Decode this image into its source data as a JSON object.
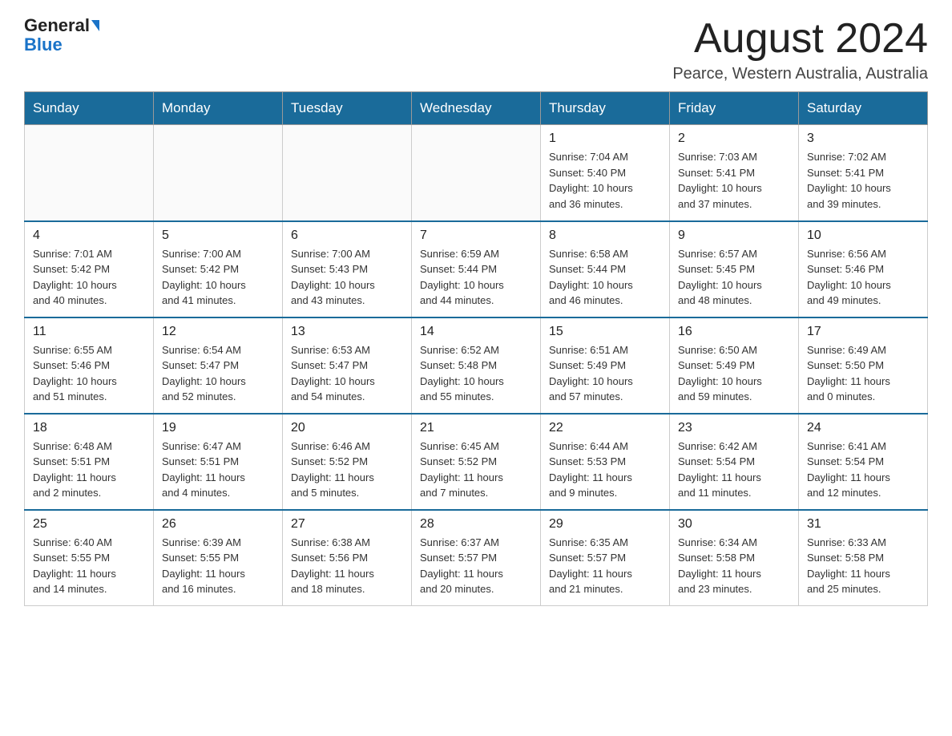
{
  "header": {
    "logo_general": "General",
    "logo_blue": "Blue",
    "month_title": "August 2024",
    "location": "Pearce, Western Australia, Australia"
  },
  "weekdays": [
    "Sunday",
    "Monday",
    "Tuesday",
    "Wednesday",
    "Thursday",
    "Friday",
    "Saturday"
  ],
  "weeks": [
    {
      "days": [
        {
          "num": "",
          "info": ""
        },
        {
          "num": "",
          "info": ""
        },
        {
          "num": "",
          "info": ""
        },
        {
          "num": "",
          "info": ""
        },
        {
          "num": "1",
          "info": "Sunrise: 7:04 AM\nSunset: 5:40 PM\nDaylight: 10 hours\nand 36 minutes."
        },
        {
          "num": "2",
          "info": "Sunrise: 7:03 AM\nSunset: 5:41 PM\nDaylight: 10 hours\nand 37 minutes."
        },
        {
          "num": "3",
          "info": "Sunrise: 7:02 AM\nSunset: 5:41 PM\nDaylight: 10 hours\nand 39 minutes."
        }
      ]
    },
    {
      "days": [
        {
          "num": "4",
          "info": "Sunrise: 7:01 AM\nSunset: 5:42 PM\nDaylight: 10 hours\nand 40 minutes."
        },
        {
          "num": "5",
          "info": "Sunrise: 7:00 AM\nSunset: 5:42 PM\nDaylight: 10 hours\nand 41 minutes."
        },
        {
          "num": "6",
          "info": "Sunrise: 7:00 AM\nSunset: 5:43 PM\nDaylight: 10 hours\nand 43 minutes."
        },
        {
          "num": "7",
          "info": "Sunrise: 6:59 AM\nSunset: 5:44 PM\nDaylight: 10 hours\nand 44 minutes."
        },
        {
          "num": "8",
          "info": "Sunrise: 6:58 AM\nSunset: 5:44 PM\nDaylight: 10 hours\nand 46 minutes."
        },
        {
          "num": "9",
          "info": "Sunrise: 6:57 AM\nSunset: 5:45 PM\nDaylight: 10 hours\nand 48 minutes."
        },
        {
          "num": "10",
          "info": "Sunrise: 6:56 AM\nSunset: 5:46 PM\nDaylight: 10 hours\nand 49 minutes."
        }
      ]
    },
    {
      "days": [
        {
          "num": "11",
          "info": "Sunrise: 6:55 AM\nSunset: 5:46 PM\nDaylight: 10 hours\nand 51 minutes."
        },
        {
          "num": "12",
          "info": "Sunrise: 6:54 AM\nSunset: 5:47 PM\nDaylight: 10 hours\nand 52 minutes."
        },
        {
          "num": "13",
          "info": "Sunrise: 6:53 AM\nSunset: 5:47 PM\nDaylight: 10 hours\nand 54 minutes."
        },
        {
          "num": "14",
          "info": "Sunrise: 6:52 AM\nSunset: 5:48 PM\nDaylight: 10 hours\nand 55 minutes."
        },
        {
          "num": "15",
          "info": "Sunrise: 6:51 AM\nSunset: 5:49 PM\nDaylight: 10 hours\nand 57 minutes."
        },
        {
          "num": "16",
          "info": "Sunrise: 6:50 AM\nSunset: 5:49 PM\nDaylight: 10 hours\nand 59 minutes."
        },
        {
          "num": "17",
          "info": "Sunrise: 6:49 AM\nSunset: 5:50 PM\nDaylight: 11 hours\nand 0 minutes."
        }
      ]
    },
    {
      "days": [
        {
          "num": "18",
          "info": "Sunrise: 6:48 AM\nSunset: 5:51 PM\nDaylight: 11 hours\nand 2 minutes."
        },
        {
          "num": "19",
          "info": "Sunrise: 6:47 AM\nSunset: 5:51 PM\nDaylight: 11 hours\nand 4 minutes."
        },
        {
          "num": "20",
          "info": "Sunrise: 6:46 AM\nSunset: 5:52 PM\nDaylight: 11 hours\nand 5 minutes."
        },
        {
          "num": "21",
          "info": "Sunrise: 6:45 AM\nSunset: 5:52 PM\nDaylight: 11 hours\nand 7 minutes."
        },
        {
          "num": "22",
          "info": "Sunrise: 6:44 AM\nSunset: 5:53 PM\nDaylight: 11 hours\nand 9 minutes."
        },
        {
          "num": "23",
          "info": "Sunrise: 6:42 AM\nSunset: 5:54 PM\nDaylight: 11 hours\nand 11 minutes."
        },
        {
          "num": "24",
          "info": "Sunrise: 6:41 AM\nSunset: 5:54 PM\nDaylight: 11 hours\nand 12 minutes."
        }
      ]
    },
    {
      "days": [
        {
          "num": "25",
          "info": "Sunrise: 6:40 AM\nSunset: 5:55 PM\nDaylight: 11 hours\nand 14 minutes."
        },
        {
          "num": "26",
          "info": "Sunrise: 6:39 AM\nSunset: 5:55 PM\nDaylight: 11 hours\nand 16 minutes."
        },
        {
          "num": "27",
          "info": "Sunrise: 6:38 AM\nSunset: 5:56 PM\nDaylight: 11 hours\nand 18 minutes."
        },
        {
          "num": "28",
          "info": "Sunrise: 6:37 AM\nSunset: 5:57 PM\nDaylight: 11 hours\nand 20 minutes."
        },
        {
          "num": "29",
          "info": "Sunrise: 6:35 AM\nSunset: 5:57 PM\nDaylight: 11 hours\nand 21 minutes."
        },
        {
          "num": "30",
          "info": "Sunrise: 6:34 AM\nSunset: 5:58 PM\nDaylight: 11 hours\nand 23 minutes."
        },
        {
          "num": "31",
          "info": "Sunrise: 6:33 AM\nSunset: 5:58 PM\nDaylight: 11 hours\nand 25 minutes."
        }
      ]
    }
  ]
}
